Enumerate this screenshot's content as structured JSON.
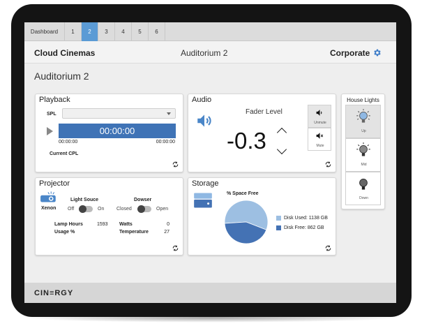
{
  "tabs": [
    {
      "label": "Dashboard",
      "active": false
    },
    {
      "label": "1",
      "active": false
    },
    {
      "label": "2",
      "active": true
    },
    {
      "label": "3",
      "active": false
    },
    {
      "label": "4",
      "active": false
    },
    {
      "label": "5",
      "active": false
    },
    {
      "label": "6",
      "active": false
    }
  ],
  "header": {
    "brand": "Cloud Cinemas",
    "title": "Auditorium 2",
    "account": "Corporate"
  },
  "page_title": "Auditorium 2",
  "playback": {
    "title": "Playback",
    "spl_label": "SPL",
    "spl_value": "",
    "timecode": "00:00:00",
    "time_start": "00:00:00",
    "time_end": "00:00:00",
    "current_cpl_label": "Current CPL"
  },
  "audio": {
    "title": "Audio",
    "fader_label": "Fader Level",
    "fader_value": "-0.3",
    "unmute_label": "Unmute",
    "mute_label": "Mute"
  },
  "house_lights": {
    "title": "House Lights",
    "levels": [
      {
        "label": "Up",
        "selected": true
      },
      {
        "label": "Mid",
        "selected": false
      },
      {
        "label": "Down",
        "selected": false
      }
    ]
  },
  "projector": {
    "title": "Projector",
    "brand": "Xenon",
    "light_source_label": "Light Souce",
    "light_off": "Off",
    "light_on": "On",
    "dowser_label": "Dowser",
    "dowser_closed": "Closed",
    "dowser_open": "Open",
    "lamp_hours_label": "Lamp Hours",
    "lamp_hours_value": "1593",
    "watts_label": "Watts",
    "watts_value": "0",
    "usage_label": "Usage %",
    "usage_value": "",
    "temperature_label": "Temperature",
    "temperature_value": "27"
  },
  "storage": {
    "title": "Storage",
    "chart_title": "% Space Free",
    "used_label": "Disk Used: 1138 GB",
    "free_label": "Disk Free: 862 GB"
  },
  "footer": {
    "logo": "CIN≡RGY"
  },
  "colors": {
    "accent": "#5b9bd5",
    "disk_used": "#9dbfe2",
    "disk_free": "#4472b4"
  },
  "chart_data": {
    "type": "pie",
    "title": "% Space Free",
    "categories": [
      "Disk Used",
      "Disk Free"
    ],
    "values": [
      1138,
      862
    ],
    "unit": "GB"
  }
}
